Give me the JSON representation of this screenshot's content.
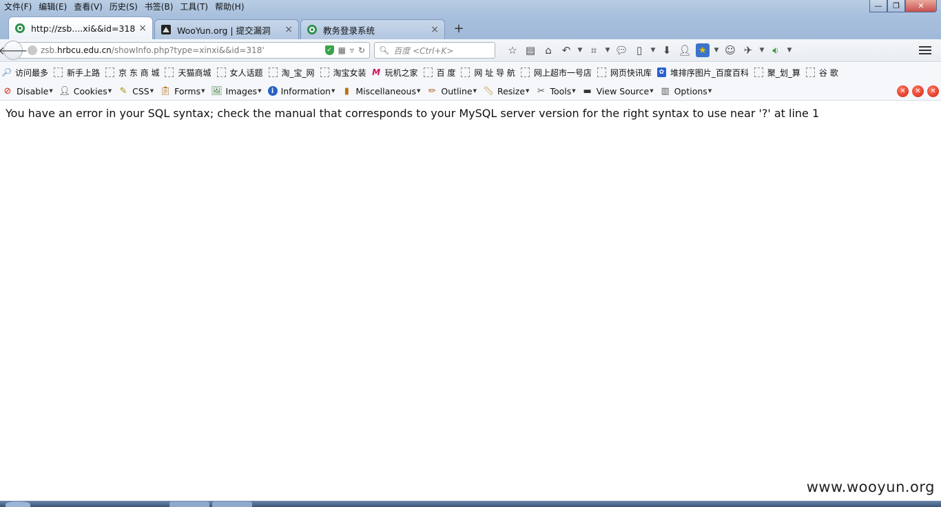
{
  "menubar": {
    "items": [
      "文件(F)",
      "编辑(E)",
      "查看(V)",
      "历史(S)",
      "书签(B)",
      "工具(T)",
      "帮助(H)"
    ]
  },
  "window_controls": {
    "minimize": "—",
    "maximize": "❐",
    "close": "✕"
  },
  "tabs": [
    {
      "title": "http://zsb....xi&&id=318'",
      "active": true
    },
    {
      "title": "WooYun.org | 提交漏洞",
      "active": false
    },
    {
      "title": "教务登录系统",
      "active": false
    }
  ],
  "tab_close_glyph": "×",
  "new_tab_glyph": "+",
  "navbar": {
    "url_host_prefix": "zsb.",
    "url_host": "hrbcu.edu.cn",
    "url_path": "/showInfo.php?type=xinxi&&id=318'",
    "search_placeholder": "百度 <Ctrl+K>"
  },
  "bookmarks": [
    "访问最多",
    "新手上路",
    "京 东 商 城",
    "天猫商城",
    "女人话题",
    "淘_宝_网",
    "淘宝女装",
    "玩机之家",
    "百 度",
    "网 址 导 航",
    "网上超市一号店",
    "网页快讯库",
    "堆排序图片_百度百科",
    "聚_划_算",
    "谷 歌"
  ],
  "devbar": [
    "Disable",
    "Cookies",
    "CSS",
    "Forms",
    "Images",
    "Information",
    "Miscellaneous",
    "Outline",
    "Resize",
    "Tools",
    "View Source",
    "Options"
  ],
  "content": {
    "error_message": "You have an error in your SQL syntax; check the manual that corresponds to your MySQL server version for the right syntax to use near '?' at line 1",
    "watermark": "www.wooyun.org"
  }
}
